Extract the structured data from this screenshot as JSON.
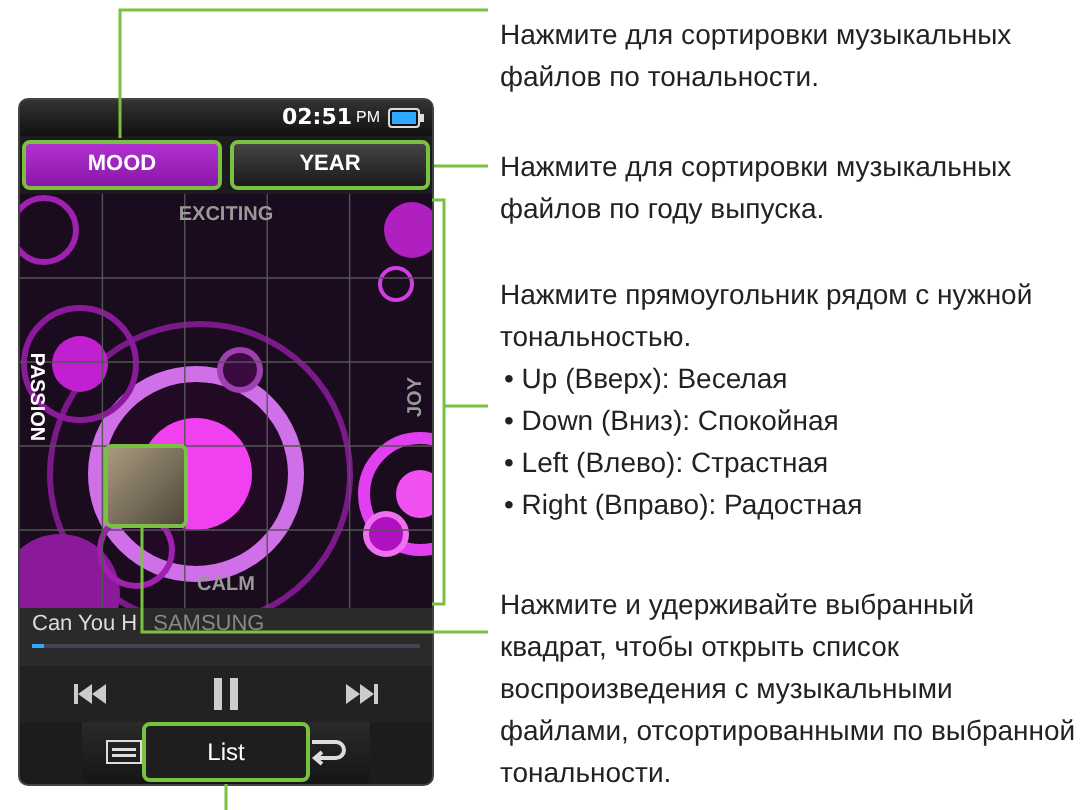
{
  "device": {
    "status_bar": {
      "time": "02:51",
      "ampm": "PM"
    },
    "tabs": [
      {
        "label": "MOOD",
        "selected": true
      },
      {
        "label": "YEAR",
        "selected": false
      }
    ],
    "mood_grid": {
      "top": "EXCITING",
      "bottom": "CALM",
      "left": "PASSION",
      "right": "JOY"
    },
    "now_playing": {
      "title": "Can You H",
      "artist": "SAMSUNG",
      "level": 0.03
    },
    "bottom_bar": {
      "list_button": "List"
    }
  },
  "callouts": [
    {
      "text": "Нажмите для сортировки музыкальных файлов по тональности."
    },
    {
      "text": "Нажмите для сортировки музыкальных файлов по году выпуска."
    },
    {
      "text": "Нажмите прямоугольник рядом с нужной тональностью.",
      "bullets": [
        "• Up (Вверх): Веселая",
        "• Down (Вниз): Спокойная",
        "• Left (Влево): Страстная",
        "• Right (Вправо): Радостная"
      ]
    },
    {
      "text": "Нажмите и удерживайте выбранный квадрат, чтобы открыть список воспроизведения с музыкальными файлами, отсортированными по выбранной тональности."
    }
  ]
}
